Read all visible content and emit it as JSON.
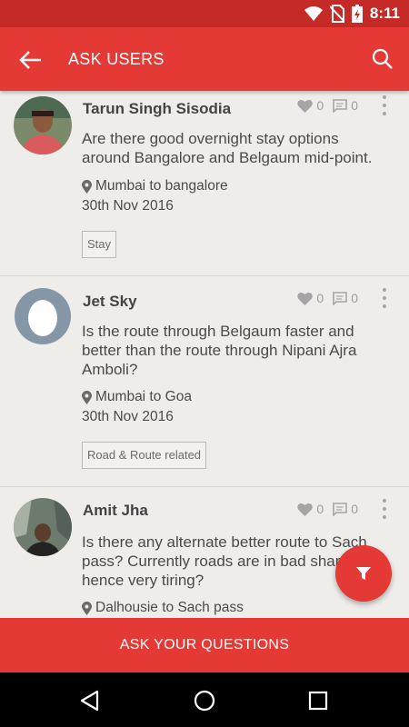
{
  "status_bar": {
    "time": "8:11"
  },
  "app_bar": {
    "title": "ASK USERS"
  },
  "posts": [
    {
      "user": "Tarun Singh Sisodia",
      "likes": "0",
      "comments": "0",
      "question": "Are there good overnight stay options around Bangalore and Belgaum mid-point.",
      "route": "Mumbai to bangalore",
      "date": "30th Nov 2016",
      "tag": "Stay"
    },
    {
      "user": "Jet Sky",
      "likes": "0",
      "comments": "0",
      "question": "Is the route through Belgaum faster and better than the route through  Nipani Ajra Amboli?",
      "route": "Mumbai to Goa",
      "date": "30th Nov 2016",
      "tag": "Road & Route related"
    },
    {
      "user": "Amit Jha",
      "likes": "0",
      "comments": "0",
      "question": "Is there any alternate better route to Sach pass? Currently roads are in bad shape hence very tiring?",
      "route": "Dalhousie to Sach pass"
    }
  ],
  "ask_button": "ASK YOUR QUESTIONS",
  "colors": {
    "primary": "#e53935",
    "status_bar": "#c62a26",
    "background": "#efedea"
  }
}
